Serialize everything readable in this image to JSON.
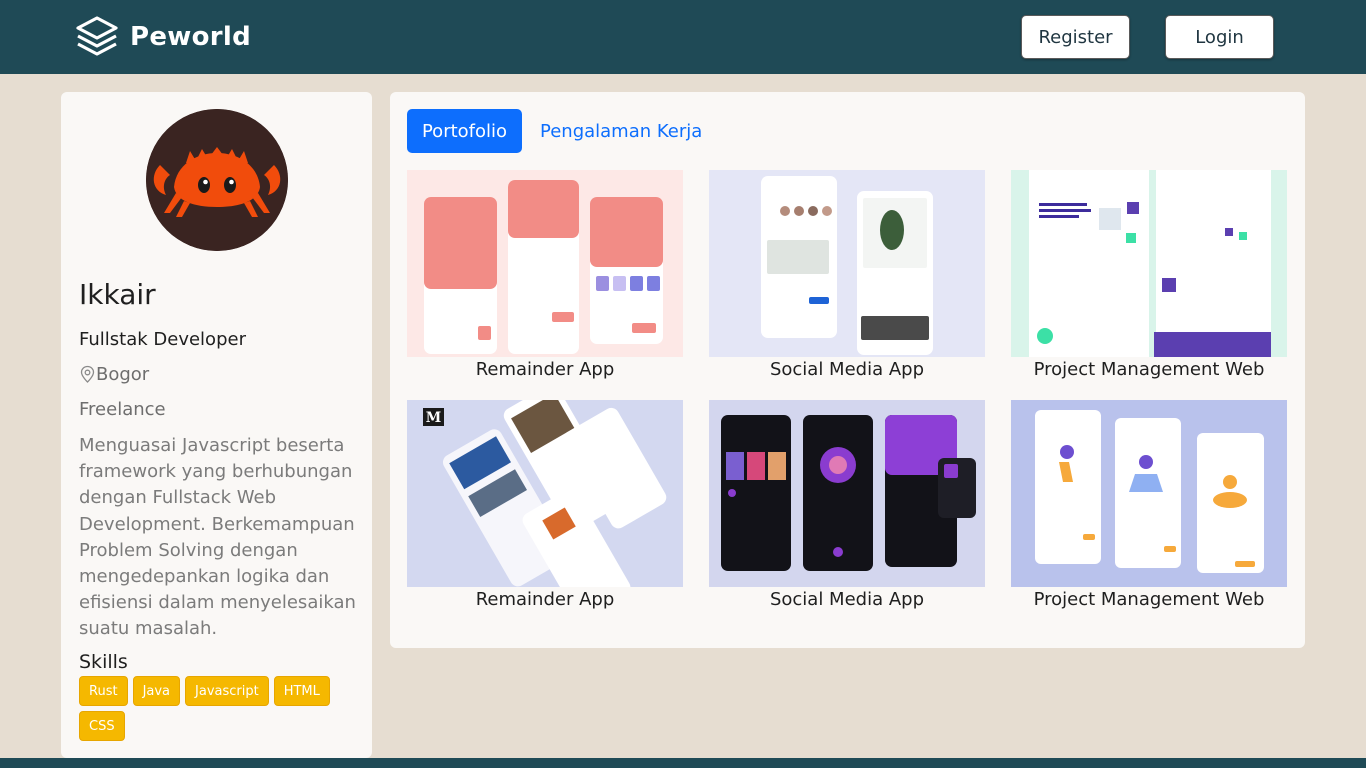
{
  "navbar": {
    "brand": "Peworld",
    "brand_icon": "stacked-layers-icon",
    "register_label": "Register",
    "login_label": "Login",
    "background": "#1f4a56"
  },
  "profile": {
    "name": "Ikkair",
    "job": "Fullstak Developer",
    "location": "Bogor",
    "status": "Freelance",
    "description": "Menguasai Javascript beserta framework yang berhubungan dengan Fullstack Web Development. Berkemampuan Problem Solving dengan mengedepankan logika dan efisiensi dalam menyelesaikan suatu masalah.",
    "skills_title": "Skills",
    "skills": [
      "Rust",
      "Java",
      "Javascript",
      "HTML",
      "CSS"
    ],
    "skill_color": "#f5b800"
  },
  "tabs": {
    "portfolio": "Portofolio",
    "experience": "Pengalaman Kerja",
    "active_color": "#0d6efd"
  },
  "portfolio": [
    {
      "title": "Remainder App"
    },
    {
      "title": "Social Media App"
    },
    {
      "title": "Project Management Web"
    },
    {
      "title": "Remainder App"
    },
    {
      "title": "Social Media App"
    },
    {
      "title": "Project Management Web"
    }
  ],
  "icons": {
    "location": "location-pin-icon",
    "avatar": "crab-mascot-avatar"
  }
}
